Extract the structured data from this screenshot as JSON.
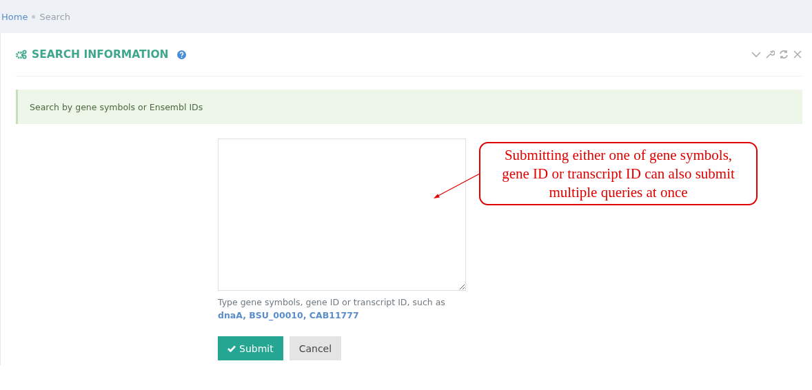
{
  "breadcrumb": [
    {
      "label": "Home",
      "link": true
    },
    {
      "label": "Search",
      "link": false
    }
  ],
  "panel": {
    "title": "SEARCH INFORMATION"
  },
  "alert": "Search by gene symbols or Ensembl IDs",
  "hint": "Type gene symbols, gene ID or transcript ID, such as",
  "examples": [
    "dnaA",
    "BSU_00010",
    "CAB11777"
  ],
  "example_separator": ", ",
  "buttons": [
    {
      "label": "Submit",
      "kind": "primary"
    },
    {
      "label": "Cancel",
      "kind": "default"
    }
  ],
  "callout": "Submitting either one of gene symbols, gene ID or transcript ID can also submit multiple queries at once"
}
